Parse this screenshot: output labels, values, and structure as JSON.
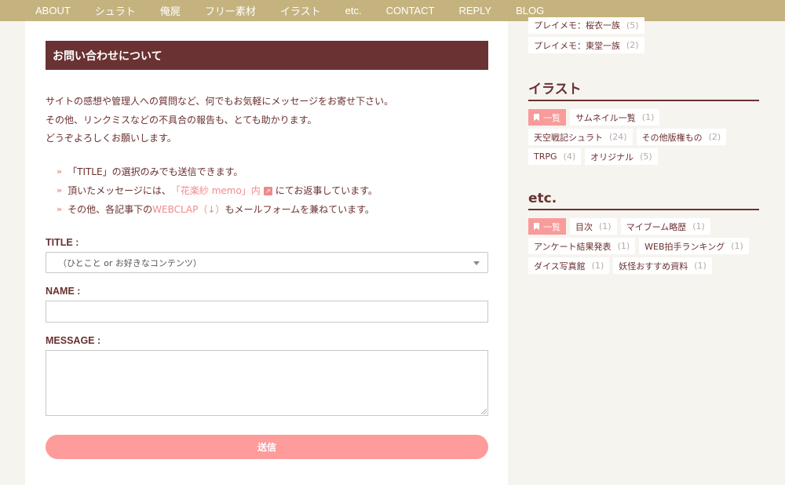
{
  "nav": [
    "ABOUT",
    "シュラト",
    "俺屍",
    "フリー素材",
    "イラスト",
    "etc.",
    "CONTACT",
    "REPLY",
    "BLOG"
  ],
  "main": {
    "heading": "お問い合わせについて",
    "intro": [
      "サイトの感想や管理人への質問など、何でもお気軽にメッセージをお寄せ下さい。",
      "その他、リンクミスなどの不具合の報告も、とても助かります。",
      "どうぞよろしくお願いします。"
    ],
    "bullets": {
      "mark": "»",
      "b1": "「TITLE」の選択のみでも送信できます。",
      "b2_pre": "頂いたメッセージには、",
      "b2_link": "「花楽紗 memo」内",
      "b2_post": "にてお返事しています。",
      "b3_pre": "その他、各記事下の",
      "b3_link": "WEBCLAP（↓）",
      "b3_post": "もメールフォームを兼ねています。"
    },
    "form": {
      "title_label": "TITLE :",
      "title_selected": "（ひとこと or お好きなコンテンツ）",
      "name_label": "NAME :",
      "name_value": "",
      "message_label": "MESSAGE :",
      "message_value": "",
      "submit": "送信"
    }
  },
  "sidebar": {
    "top_tags": [
      {
        "label": "プレイメモ：桜衣一族",
        "count": "(5)"
      },
      {
        "label": "プレイメモ：東堂一族",
        "count": "(2)"
      }
    ],
    "illust": {
      "title": "イラスト",
      "all": "一覧",
      "tags": [
        {
          "label": "サムネイル一覧",
          "count": "(1)"
        },
        {
          "label": "天空戦記シュラト",
          "count": "(24)"
        },
        {
          "label": "その他版権もの",
          "count": "(2)"
        },
        {
          "label": "TRPG",
          "count": "(4)"
        },
        {
          "label": "オリジナル",
          "count": "(5)"
        }
      ]
    },
    "etc": {
      "title": "etc.",
      "all": "一覧",
      "tags": [
        {
          "label": "目次",
          "count": "(1)"
        },
        {
          "label": "マイブーム略歴",
          "count": "(1)"
        },
        {
          "label": "アンケート結果発表",
          "count": "(1)"
        },
        {
          "label": "WEB拍手ランキング",
          "count": "(1)"
        },
        {
          "label": "ダイス写真館",
          "count": "(1)"
        },
        {
          "label": "妖怪おすすめ資料",
          "count": "(1)"
        }
      ]
    }
  }
}
